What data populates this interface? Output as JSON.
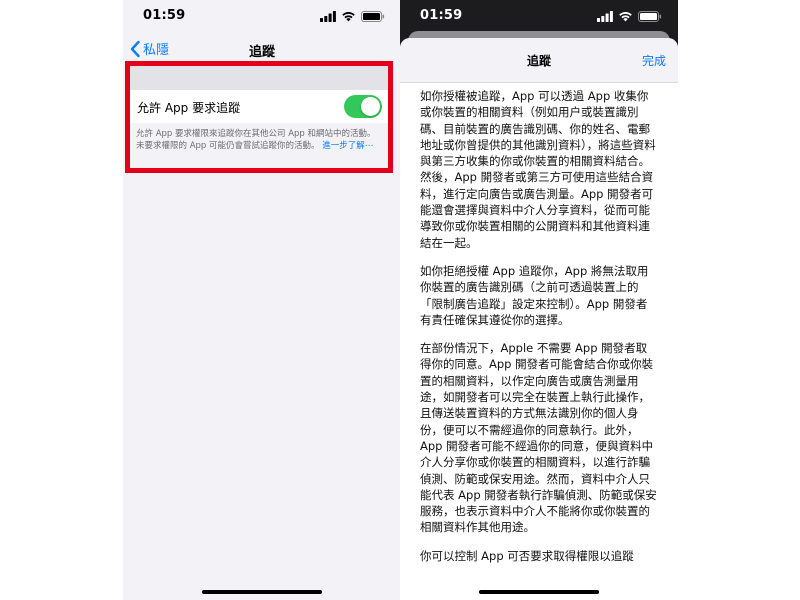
{
  "left_screen": {
    "status": {
      "time": "01:59"
    },
    "nav": {
      "back_label": "私隱",
      "title": "追蹤"
    },
    "setting": {
      "label": "允許 App 要求追蹤",
      "toggle_on": true
    },
    "footnote": {
      "text": "允許 App 要求權限來追蹤你在其他公司 App 和網站中的活動。未要求權限的 App 可能仍會嘗試追蹤你的活動。",
      "link": "進一步了解⋯"
    }
  },
  "right_screen": {
    "status": {
      "time": "01:59"
    },
    "sheet": {
      "title": "追蹤",
      "done_label": "完成",
      "paragraphs": [
        "如你授權被追蹤，App 可以透過 App 收集你或你裝置的相關資料（例如用户或裝置識別碼、目前裝置的廣告識別碼、你的姓名、電郵地址或你曾提供的其他識別資料），將這些資料與第三方收集的你或你裝置的相關資料結合。然後，App 開發者或第三方可使用這些結合資料，進行定向廣告或廣告測量。App 開發者可能還會選擇與資料中介人分享資料，從而可能導致你或你裝置相關的公開資料和其他資料連結在一起。",
        "如你拒絕授權 App 追蹤你，App 將無法取用你裝置的廣告識別碼（之前可透過裝置上的「限制廣告追蹤」設定來控制）。App 開發者有責任確保其遵從你的選擇。",
        "在部份情況下，Apple 不需要 App 開發者取得你的同意。App 開發者可能會結合你或你裝置的相關資料，以作定向廣告或廣告測量用途，如開發者可以完全在裝置上執行此操作，且傳送裝置資料的方式無法識別你的個人身份，便可以不需經過你的同意執行。此外，App 開發者可能不經過你的同意，便與資料中介人分享你或你裝置的相關資料，以進行詐騙偵測、防範或保安用途。然而，資料中介人只能代表 App 開發者執行詐騙偵測、防範或保安服務，也表示資料中介人不能將你或你裝置的相關資料作其他用途。",
        "你可以控制 App 可否要求取得權限以追蹤"
      ]
    }
  },
  "colors": {
    "highlight": "#e4001b",
    "toggle_on": "#34c759",
    "link": "#0a7aff",
    "sheet_backdrop": "#1c1c1e",
    "grouped_background": "#f2f2f7"
  },
  "icons": [
    "chevron-left-icon",
    "signal-icon",
    "wifi-icon",
    "battery-icon"
  ]
}
